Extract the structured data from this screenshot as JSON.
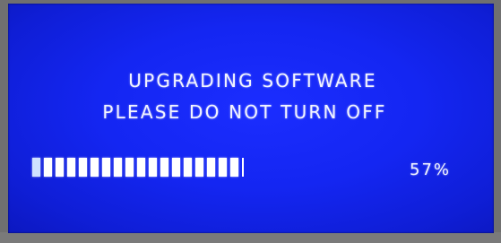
{
  "screen": {
    "background_color": "#1426f2",
    "text_color": "#f2f4ff",
    "line1": "UPGRADING SOFTWARE",
    "line2": "PLEASE DO NOT TURN OFF",
    "progress": {
      "percent_label": "57%",
      "value_fraction": 0.57,
      "filled_segments": 18,
      "bar_color": "#ffffff"
    }
  }
}
